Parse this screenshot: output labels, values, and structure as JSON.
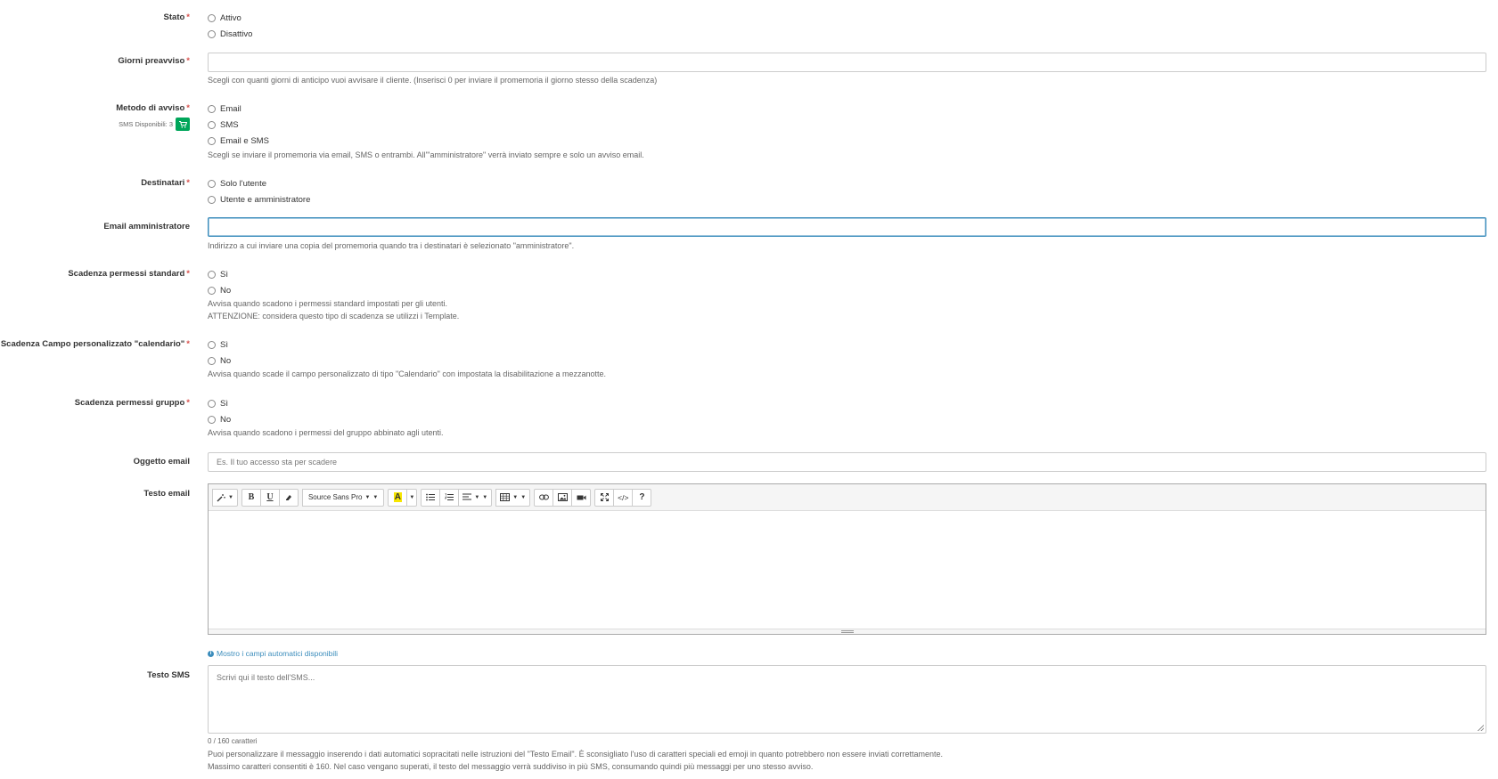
{
  "required_mark": "*",
  "stato": {
    "label": "Stato",
    "options": [
      "Attivo",
      "Disattivo"
    ]
  },
  "giorni": {
    "label": "Giorni preavviso",
    "value": "",
    "help": "Scegli con quanti giorni di anticipo vuoi avvisare il cliente. (Inserisci 0 per inviare il promemoria il giorno stesso della scadenza)"
  },
  "metodo": {
    "label": "Metodo di avviso",
    "sms_available": "SMS Disponibili: 3",
    "cart_icon": "shopping-cart-icon",
    "options": [
      "Email",
      "SMS",
      "Email e SMS"
    ],
    "help": "Scegli se inviare il promemoria via email, SMS o entrambi. All'\"amministratore\" verrà inviato sempre e solo un avviso email."
  },
  "destinatari": {
    "label": "Destinatari",
    "options": [
      "Solo l'utente",
      "Utente e amministratore"
    ]
  },
  "email_admin": {
    "label": "Email amministratore",
    "value": "",
    "help": "Indirizzo a cui inviare una copia del promemoria quando tra i destinatari è selezionato \"amministratore\"."
  },
  "scad_standard": {
    "label": "Scadenza permessi standard",
    "options": [
      "Sì",
      "No"
    ],
    "help1": "Avvisa quando scadono i permessi standard impostati per gli utenti.",
    "help2": "ATTENZIONE: considera questo tipo di scadenza se utilizzi i Template."
  },
  "scad_calendario": {
    "label": "Scadenza Campo personalizzato \"calendario\"",
    "options": [
      "Sì",
      "No"
    ],
    "help": "Avvisa quando scade il campo personalizzato di tipo \"Calendario\" con impostata la disabilitazione a mezzanotte."
  },
  "scad_gruppo": {
    "label": "Scadenza permessi gruppo",
    "options": [
      "Sì",
      "No"
    ],
    "help": "Avvisa quando scadono i permessi del gruppo abbinato agli utenti."
  },
  "oggetto": {
    "label": "Oggetto email",
    "placeholder": "Es. Il tuo accesso sta per scadere"
  },
  "testo_email": {
    "label": "Testo email",
    "font_name": "Source Sans Pro",
    "toolbar_icons": [
      "magic-wand-icon",
      "bold-icon",
      "underline-icon",
      "eraser-icon",
      "font-color-icon",
      "unordered-list-icon",
      "ordered-list-icon",
      "align-icon",
      "table-icon",
      "link-icon",
      "picture-icon",
      "video-icon",
      "fullscreen-icon",
      "code-view-icon",
      "help-icon"
    ],
    "bold_glyph": "B",
    "underline_glyph": "U",
    "color_glyph": "A",
    "code_glyph": "</>",
    "help_glyph": "?",
    "highlight_color": "#f7e600"
  },
  "auto_fields_link": "Mostro i campi automatici disponibili",
  "testo_sms": {
    "label": "Testo SMS",
    "placeholder": "Scrivi qui il testo dell'SMS...",
    "counter": "0 / 160 caratteri",
    "help1": "Puoi personalizzare il messaggio inserendo i dati automatici sopracitati nelle istruzioni del \"Testo Email\". È sconsigliato l'uso di caratteri speciali ed emoji in quanto potrebbero non essere inviati correttamente.",
    "help2": "Massimo caratteri consentiti è 160. Nel caso vengano superati, il testo del messaggio verrà suddiviso in più SMS, consumando quindi più messaggi per uno stesso avviso."
  },
  "colors": {
    "required": "#d9534f",
    "accent": "#3c8dbc",
    "cart_button": "#00a65a"
  }
}
